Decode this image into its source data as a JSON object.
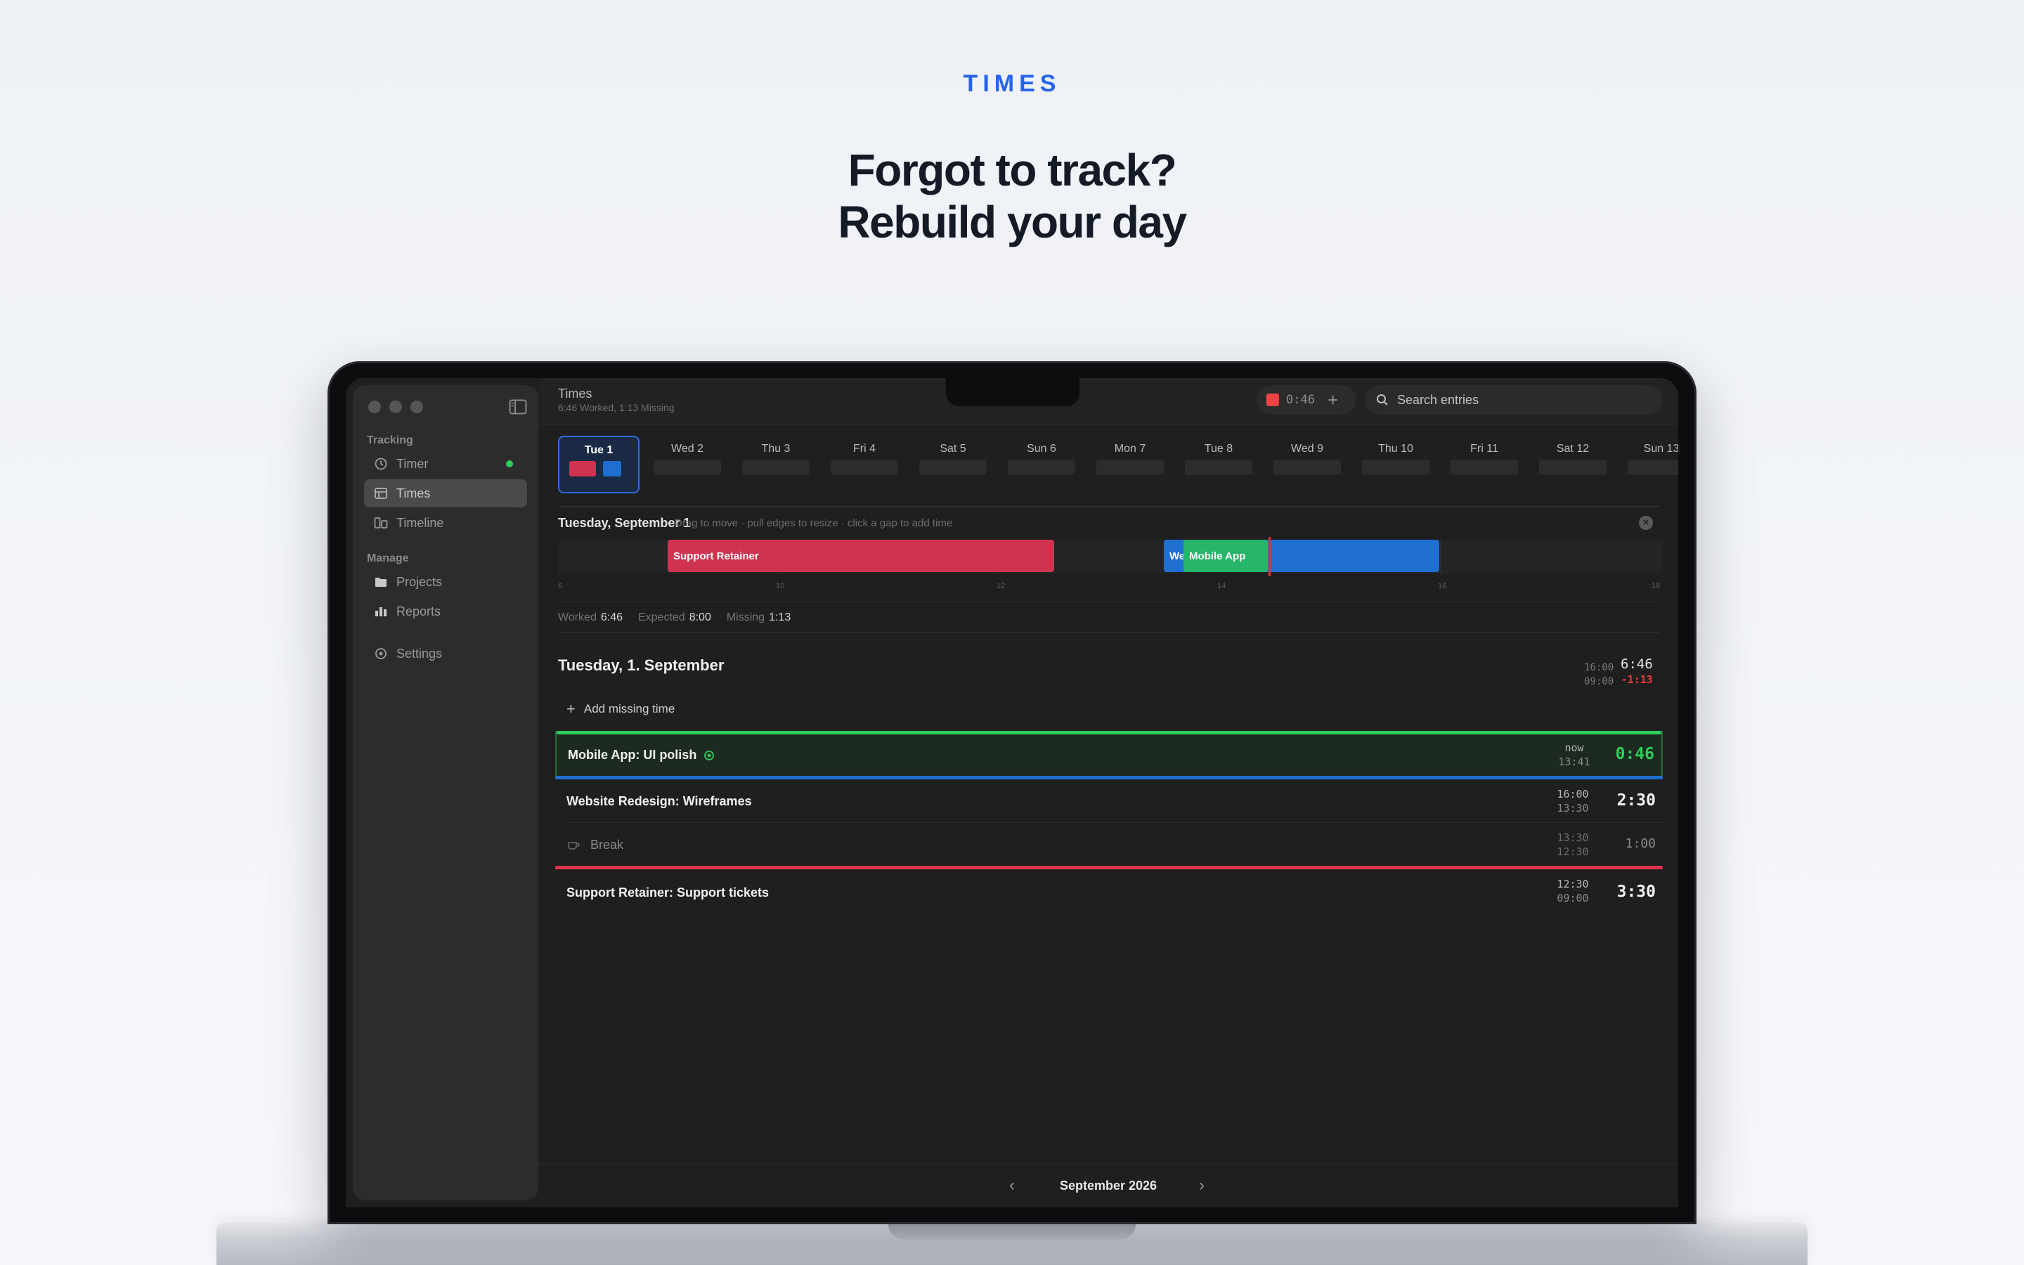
{
  "hero": {
    "eyebrow": "TIMES",
    "headline_line1": "Forgot to track?",
    "headline_line2": "Rebuild your day"
  },
  "app": {
    "title": "Times",
    "subtitle": "6:46 Worked, 1:13 Missing",
    "timer_value": "0:46",
    "timer_plus": "+",
    "search_placeholder": "Search entries"
  },
  "sidebar": {
    "sections": [
      {
        "label": "Tracking",
        "items": [
          {
            "label": "Timer",
            "icon": "clock-icon",
            "running_indicator": true
          },
          {
            "label": "Times",
            "icon": "list-icon",
            "active": true
          },
          {
            "label": "Timeline",
            "icon": "timeline-icon"
          }
        ]
      },
      {
        "label": "Manage",
        "items": [
          {
            "label": "Projects",
            "icon": "folder-icon"
          },
          {
            "label": "Reports",
            "icon": "bar-chart-icon"
          }
        ]
      }
    ],
    "settings_label": "Settings"
  },
  "days": [
    {
      "label": "Tue 1",
      "selected": true
    },
    {
      "label": "Wed 2"
    },
    {
      "label": "Thu 3"
    },
    {
      "label": "Fri 4"
    },
    {
      "label": "Sat 5"
    },
    {
      "label": "Sun 6"
    },
    {
      "label": "Mon 7"
    },
    {
      "label": "Tue 8"
    },
    {
      "label": "Wed 9"
    },
    {
      "label": "Thu 10"
    },
    {
      "label": "Fri 11"
    },
    {
      "label": "Sat 12"
    },
    {
      "label": "Sun 13"
    }
  ],
  "timeline": {
    "title": "Tuesday, September 1",
    "hint": "Drag to move · pull edges to resize · click a gap to add time",
    "blocks": [
      {
        "label": "Support Retainer",
        "color": "#d0334f"
      },
      {
        "label": "We",
        "color": "#1e6fd0"
      },
      {
        "label": "Mobile App",
        "color": "#27b56a"
      }
    ],
    "axis": [
      "6",
      "10",
      "12",
      "14",
      "16",
      "18"
    ]
  },
  "summary": {
    "worked_label": "Worked",
    "worked_value": "6:46",
    "expected_label": "Expected",
    "expected_value": "8:00",
    "missing_label": "Missing",
    "missing_value": "1:13"
  },
  "day_detail": {
    "header": "Tuesday, 1. September",
    "range_end": "16:00",
    "range_start": "09:00",
    "total_worked": "6:46",
    "total_missing": "-1:13",
    "add_missing_label": "Add missing time"
  },
  "entries": [
    {
      "name": "Mobile App: UI polish",
      "end": "now",
      "start": "13:41",
      "duration": "0:46",
      "color": "#2ecc5a",
      "running": true
    },
    {
      "name": "Website Redesign: Wireframes",
      "end": "16:00",
      "start": "13:30",
      "duration": "2:30",
      "color": "#1e6fd0"
    },
    {
      "name": "Break",
      "end": "13:30",
      "start": "12:30",
      "duration": "1:00",
      "is_break": true
    },
    {
      "name": "Support Retainer: Support tickets",
      "end": "12:30",
      "start": "09:00",
      "duration": "3:30",
      "color": "#e0334f"
    }
  ],
  "footer": {
    "month": "September 2026",
    "prev": "‹",
    "next": "›"
  },
  "colors": {
    "accent": "#2563eb",
    "running": "#2ecc5a",
    "missing": "#ef3b3b"
  }
}
